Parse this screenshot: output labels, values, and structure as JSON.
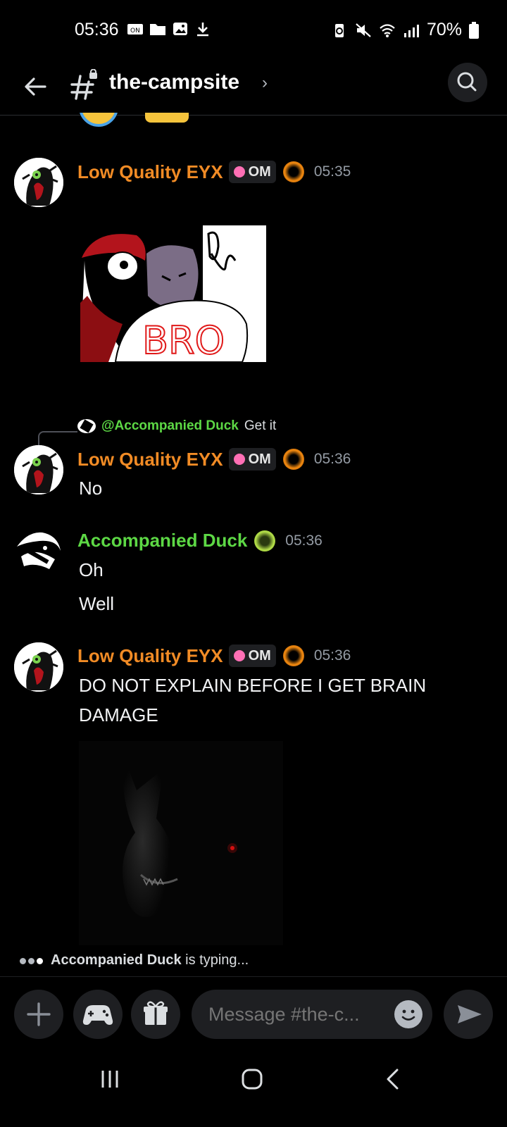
{
  "status_bar": {
    "time": "05:36",
    "battery": "70%",
    "left_icons": [
      "sim-card-icon",
      "folder-icon",
      "image-icon",
      "download-icon"
    ],
    "right_icons": [
      "battery-saver-icon",
      "mute-icon",
      "wifi-icon",
      "signal-icon",
      "battery-icon"
    ]
  },
  "header": {
    "channel": "the-campsite",
    "chevron": "›"
  },
  "messages": [
    {
      "author": "Low Quality EYX",
      "tag": "OM",
      "time": "05:35",
      "image": "bro-meme-image"
    },
    {
      "reply_to": "@Accompanied Duck",
      "reply_text": "Get it",
      "author": "Low Quality EYX",
      "tag": "OM",
      "time": "05:36",
      "lines": [
        "No"
      ]
    },
    {
      "author": "Accompanied Duck",
      "time": "05:36",
      "lines": [
        "Oh",
        "Well"
      ]
    },
    {
      "author": "Low Quality EYX",
      "tag": "OM",
      "time": "05:36",
      "lines": [
        "DO NOT EXPLAIN BEFORE I GET BRAIN",
        "DAMAGE"
      ],
      "image": "dark-creature-image"
    }
  ],
  "typing": {
    "name": "Accompanied Duck",
    "suffix": " is typing..."
  },
  "composer": {
    "placeholder": "Message #the-c..."
  },
  "colors": {
    "eyx": "#f18b25",
    "duck": "#5dd845",
    "background": "#000000"
  }
}
